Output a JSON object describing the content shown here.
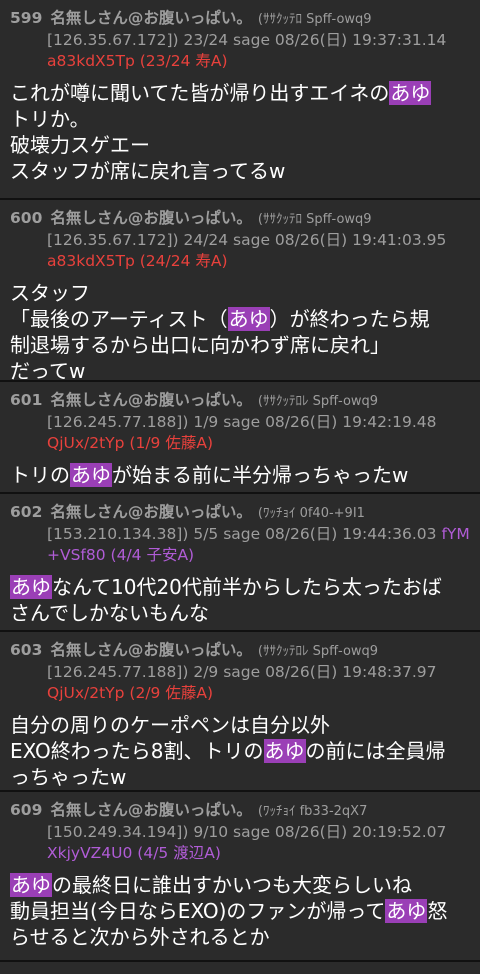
{
  "posts": [
    {
      "num": "599",
      "name": "名無しさん@お腹いっぱい。",
      "handle": "(ｻｻｸｯﾃﾛ Spff-owq9",
      "line2": "[126.35.67.172]) 23/24 sage 08/26(日) 19:37:31.14",
      "id_text": "a83kdX5Tp (23/24 寿A)",
      "body": [
        [
          {
            "t": "これが噂に聞いてた皆が帰り出すエイネの"
          },
          {
            "t": "あゆ",
            "h": true
          }
        ],
        [
          {
            "t": "トリか。"
          }
        ],
        [
          {
            "t": "破壊力スゲエー"
          }
        ],
        [
          {
            "t": "スタッフが席に戻れ言ってるw"
          }
        ]
      ]
    },
    {
      "num": "600",
      "name": "名無しさん@お腹いっぱい。",
      "handle": "(ｻｻｸｯﾃﾛ Spff-owq9",
      "line2": "[126.35.67.172]) 24/24 sage 08/26(日) 19:41:03.95",
      "id_text": "a83kdX5Tp (24/24 寿A)",
      "body": [
        [
          {
            "t": "スタッフ"
          }
        ],
        [
          {
            "t": "「最後のアーティスト（"
          },
          {
            "t": "あゆ",
            "h": true
          },
          {
            "t": "）が終わったら規"
          }
        ],
        [
          {
            "t": "制退場するから出口に向かわず席に戻れ」"
          }
        ],
        [
          {
            "t": "だってw"
          }
        ]
      ]
    },
    {
      "num": "601",
      "name": "名無しさん@お腹いっぱい。",
      "handle": "(ｻｻｸｯﾃﾛﾚ Spff-owq9",
      "line2": "[126.245.77.188]) 1/9 sage 08/26(日) 19:42:19.48",
      "id_text": "QjUx/2tYp (1/9 佐藤A)",
      "body": [
        [
          {
            "t": "トリの"
          },
          {
            "t": "あゆ",
            "h": true
          },
          {
            "t": "が始まる前に半分帰っちゃったw"
          }
        ]
      ]
    },
    {
      "num": "602",
      "name": "名無しさん@お腹いっぱい。",
      "handle": "(ﾜｯﾁｮｲ 0f40-+9I1",
      "line2": "[153.210.134.38]) 5/5 sage 08/26(日) 19:44:36.03",
      "line2_tail": "fYM",
      "id_text": "+VSf80 (4/4 子安A)",
      "id_purple": true,
      "body": [
        [
          {
            "t": "あゆ",
            "h": true
          },
          {
            "t": "なんて10代20代前半からしたら太ったおば"
          }
        ],
        [
          {
            "t": "さんでしかないもんな"
          }
        ]
      ]
    },
    {
      "num": "603",
      "name": "名無しさん@お腹いっぱい。",
      "handle": "(ｻｻｸｯﾃﾛﾚ Spff-owq9",
      "line2": "[126.245.77.188]) 2/9 sage 08/26(日) 19:48:37.97",
      "id_text": "QjUx/2tYp (2/9 佐藤A)",
      "body": [
        [
          {
            "t": "自分の周りのケーポペンは自分以外"
          }
        ],
        [
          {
            "t": "EXO終わったら8割、トリの"
          },
          {
            "t": "あゆ",
            "h": true
          },
          {
            "t": "の前には全員帰"
          }
        ],
        [
          {
            "t": "っちゃったw"
          }
        ]
      ]
    },
    {
      "num": "609",
      "name": "名無しさん@お腹いっぱい。",
      "handle": "(ﾜｯﾁｮｲ fb33-2qX7",
      "line2": "[150.249.34.194]) 9/10 sage 08/26(日) 20:19:52.07",
      "id_text": "XkjyVZ4U0 (4/5 渡辺A)",
      "id_purple": true,
      "body": [
        [
          {
            "t": "あゆ",
            "h": true
          },
          {
            "t": "の最終日に誰出すかいつも大変らしいね"
          }
        ],
        [
          {
            "t": "動員担当(今日ならEXO)のファンが帰って"
          },
          {
            "t": "あゆ",
            "h": true
          },
          {
            "t": "怒"
          }
        ],
        [
          {
            "t": "らせると次から外されるとか"
          }
        ]
      ]
    }
  ]
}
